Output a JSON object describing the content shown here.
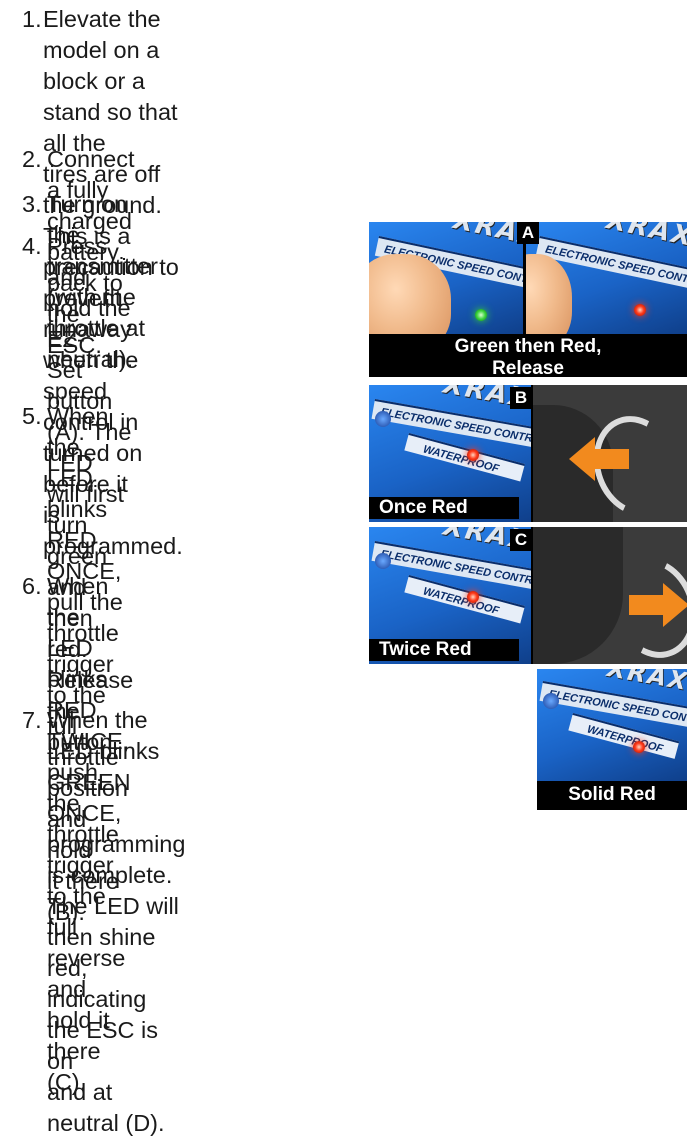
{
  "steps": [
    {
      "num": "1.",
      "lines": [
        "Elevate the model on a block or a stand so that all the",
        "tires are off the ground. This is a precaution to prevent",
        "runaway when the speed control in turned on before it",
        "is programmed."
      ]
    },
    {
      "num": "2.",
      "lines": [
        "Connect a fully charged battery pack to the ESC."
      ]
    },
    {
      "num": "3.",
      "lines": [
        "Turn on the transmitter (with the throttle at neutral)."
      ]
    },
    {
      "num": "4.",
      "lines": [
        "Press and hold the EZ-",
        "Set button (A). The LED",
        "will first turn green and",
        "then red. Release the",
        "button."
      ]
    },
    {
      "num": "5.",
      "lines": [
        "When the LED blinks",
        "RED ONCE, pull the",
        "throttle trigger to the full",
        "throttle position and hold",
        "it there (B)."
      ]
    },
    {
      "num": "6.",
      "lines": [
        "When the LED blinks RED",
        "TWICE, push the throttle",
        "trigger to the full reverse",
        "and hold it there (C)."
      ]
    },
    {
      "num": "7.",
      "lines": [
        "When the LED blinks GREEN ONCE,",
        "programming is complete. The LED will",
        "then shine red, indicating the ESC is on",
        "and at neutral (D)."
      ]
    }
  ],
  "panels": {
    "a": {
      "letter": "A",
      "caption_line1": "Green then Red,",
      "caption_line2": "Release"
    },
    "b": {
      "letter": "B",
      "caption": "Once Red"
    },
    "c": {
      "letter": "C",
      "caption": "Twice Red"
    },
    "d": {
      "caption": "Solid Red"
    }
  },
  "esc_label_text": "ELECTRONIC SPEED CONTROL",
  "esc_logo_text": "XRAX",
  "esc_sublabel_text": "WATERPROOF",
  "colors": {
    "panel_bg": "#000000",
    "esc_blue": "#1d6ed6",
    "led_red": "#ff3a1a",
    "led_green": "#38d33a",
    "arrow_orange": "#f28a1e",
    "text": "#1a1a1a"
  }
}
